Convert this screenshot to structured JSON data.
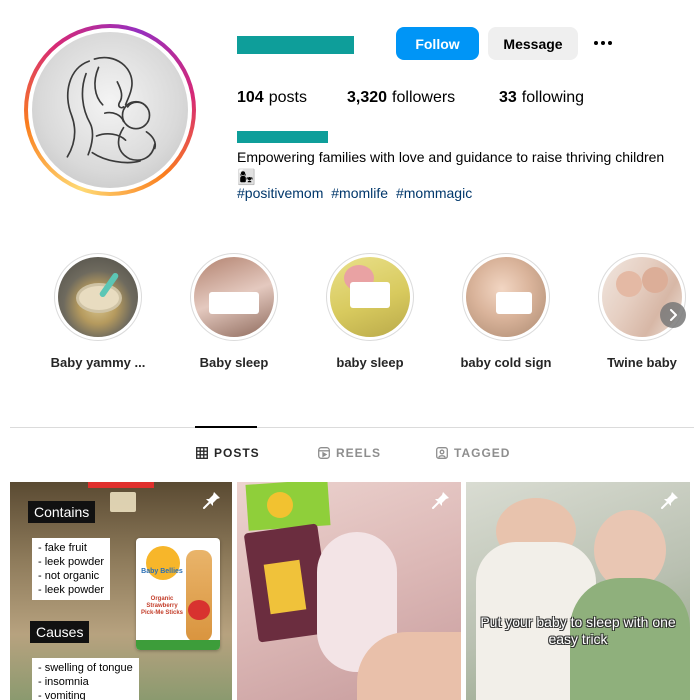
{
  "header": {
    "follow_label": "Follow",
    "message_label": "Message"
  },
  "stats": {
    "posts_count": "104",
    "posts_label": "posts",
    "followers_count": "3,320",
    "followers_label": "followers",
    "following_count": "33",
    "following_label": "following"
  },
  "bio": {
    "text": "Empowering families with love and guidance to raise thriving children",
    "emoji": "👩‍👧",
    "hashtags": [
      "#positivemom",
      "#momlife",
      "#mommagic"
    ]
  },
  "highlights": [
    {
      "label": "Baby yammy ..."
    },
    {
      "label": "Baby sleep"
    },
    {
      "label": "baby sleep"
    },
    {
      "label": "baby cold sign"
    },
    {
      "label": "Twine baby"
    }
  ],
  "tabs": [
    {
      "label": "POSTS",
      "icon": "grid-icon",
      "active": true
    },
    {
      "label": "REELS",
      "icon": "reels-icon",
      "active": false
    },
    {
      "label": "TAGGED",
      "icon": "tagged-icon",
      "active": false
    }
  ],
  "posts": [
    {
      "contains_title": "Contains",
      "contains_items": [
        "- fake fruit",
        "- leek powder",
        "- not organic",
        "- leek powder"
      ],
      "causes_title": "Causes",
      "causes_items": [
        "- swelling of tongue",
        "- insomnia",
        "- vomiting"
      ],
      "product_brand": "Baby Bellies",
      "product_name": "Organic Strawberry Pick-Me Sticks",
      "pinned": true
    },
    {
      "pinned": true
    },
    {
      "overlay_text": "Put your baby to sleep with one easy trick",
      "pinned": true
    }
  ],
  "colors": {
    "accent_blue": "#0095f6",
    "redacted_teal": "#0e9e9a",
    "hashtag_blue": "#00376b"
  }
}
